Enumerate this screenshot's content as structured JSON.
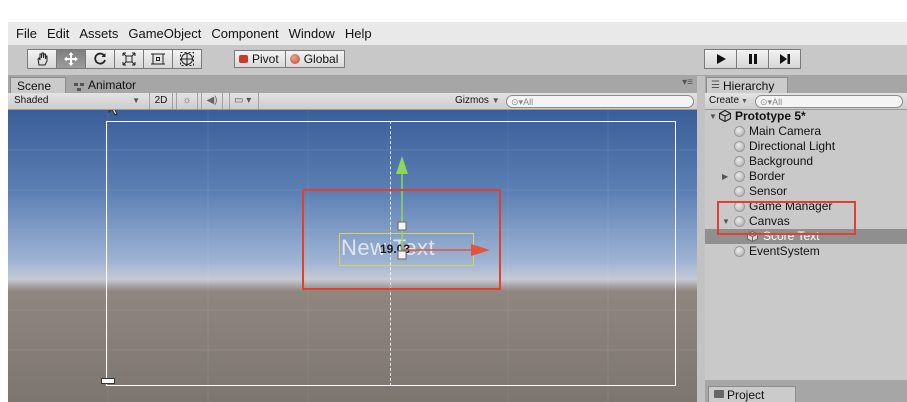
{
  "menu": [
    "File",
    "Edit",
    "Assets",
    "GameObject",
    "Component",
    "Window",
    "Help"
  ],
  "toolbar": {
    "tools": [
      "hand-tool",
      "move-tool",
      "rotate-tool",
      "scale-tool",
      "rect-tool",
      "transform-tool"
    ],
    "pivot_label": "Pivot",
    "global_label": "Global"
  },
  "scene_panel": {
    "tabs": [
      "Scene",
      "Animator"
    ],
    "shading_mode": "Shaded",
    "mode_2d": "2D",
    "gizmos_label": "Gizmos",
    "search_placeholder": "All"
  },
  "viewport": {
    "text_object": "New Text",
    "score_value": "19.03"
  },
  "hierarchy": {
    "tab_label": "Hierarchy",
    "create_label": "Create",
    "search_placeholder": "All",
    "scene_name": "Prototype 5*",
    "items": [
      {
        "label": "Main Camera"
      },
      {
        "label": "Directional Light"
      },
      {
        "label": "Background"
      },
      {
        "label": "Border"
      },
      {
        "label": "Sensor"
      },
      {
        "label": "Game Manager"
      },
      {
        "label": "Canvas"
      },
      {
        "label": "Score Text"
      },
      {
        "label": "EventSystem"
      }
    ]
  },
  "project_tab_label": "Project",
  "colors": {
    "annotation": "#e0412f",
    "selection": "#8f8f8f",
    "move_y_axis": "#8fd65a",
    "move_x_axis": "#e2553c",
    "canvas_outline": "#ffffff",
    "text_rect": "#d8d25a"
  }
}
